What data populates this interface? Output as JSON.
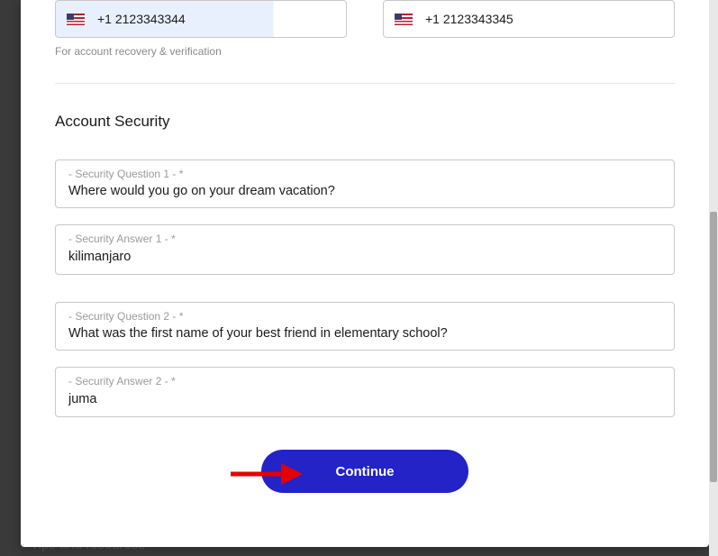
{
  "phones": {
    "phone1": "+1 2123343344",
    "phone2": "+1 2123343345",
    "helper": "For account recovery & verification"
  },
  "security": {
    "title": "Account Security",
    "q1_label": "- Security Question 1 - *",
    "q1_value": "Where would you go on your dream vacation?",
    "a1_label": "- Security Answer 1 - *",
    "a1_value": "kilimanjaro",
    "q2_label": "- Security Question 2 - *",
    "q2_value": "What was the first name of your best friend in elementary school?",
    "a2_label": "- Security Answer 2 - *",
    "a2_value": "juma"
  },
  "actions": {
    "continue": "Continue"
  },
  "background": {
    "tips": "Tips and resources"
  }
}
